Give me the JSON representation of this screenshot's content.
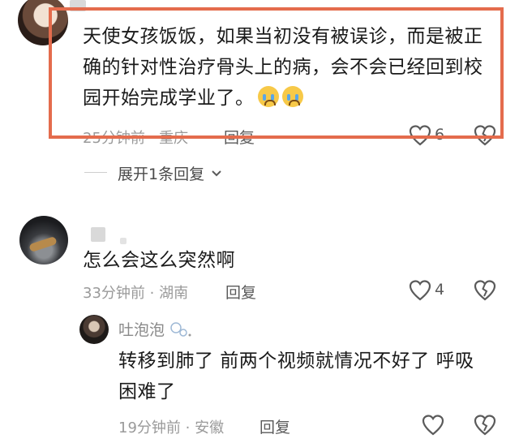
{
  "comment1": {
    "text_lines": [
      "天使女孩饭饭，如果当初没有被误诊，而是被正",
      "确的针对性治疗骨头上的病，会不会已经回到校",
      "园开始完成学业了。"
    ],
    "emoji": "crying-face",
    "time": "25分钟前 · 重庆",
    "reply_label": "回复",
    "like_count": "6"
  },
  "expand": {
    "label": "展开1条回复"
  },
  "comment2": {
    "text": "怎么会这么突然啊",
    "time": "33分钟前 · 湖南",
    "reply_label": "回复",
    "like_count": "4"
  },
  "reply1": {
    "username": "吐泡泡",
    "text_lines": [
      "转移到肺了 前两个视频就情况不好了 呼吸",
      "困难了"
    ],
    "time": "19分钟前 · 安徽",
    "reply_label": "回复"
  },
  "colors": {
    "highlight_border": "#e46c4d",
    "meta_text": "#9a9a9a"
  }
}
